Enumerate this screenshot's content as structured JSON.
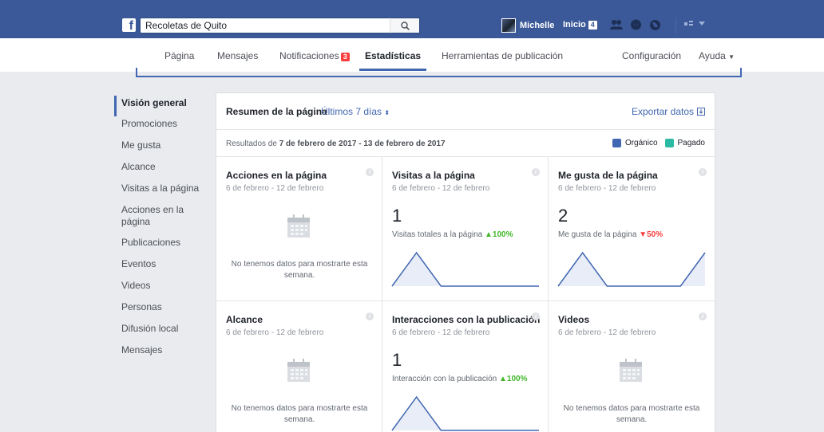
{
  "topbar": {
    "logo": "f",
    "search_value": "Recoletas de Quito",
    "user_name": "Michelle",
    "home_label": "Inicio",
    "home_count": "4"
  },
  "nav": {
    "tabs": [
      "Página",
      "Mensajes",
      "Notificaciones",
      "Estadísticas",
      "Herramientas de publicación",
      "Configuración",
      "Ayuda"
    ],
    "notifications_badge": "3",
    "active_tab": "Estadísticas"
  },
  "sidebar": {
    "items": [
      "Visión general",
      "Promociones",
      "Me gusta",
      "Alcance",
      "Visitas a la página",
      "Acciones en la página",
      "Publicaciones",
      "Eventos",
      "Videos",
      "Personas",
      "Difusión local",
      "Mensajes"
    ]
  },
  "panel": {
    "title": "Resumen de la página",
    "period": "Últimos 7 días",
    "export_label": "Exportar datos",
    "results_prefix": "Resultados de",
    "results_range": "7 de febrero de 2017 - 13 de febrero de 2017",
    "legend_organic": "Orgánico",
    "legend_paid": "Pagado",
    "colors": {
      "organic": "#4267b2",
      "paid": "#2bbba4",
      "up": "#42b72a",
      "down": "#fa3e3e"
    }
  },
  "cards": [
    {
      "title": "Acciones en la página",
      "date": "6 de febrero - 12 de febrero",
      "empty": "No tenemos datos para mostrarte esta semana."
    },
    {
      "title": "Visitas a la página",
      "date": "6 de febrero - 12 de febrero",
      "value": "1",
      "metric": "Visitas totales a la página",
      "change": "100%",
      "trend": [
        0,
        1,
        0,
        0,
        0,
        0,
        0
      ]
    },
    {
      "title": "Me gusta de la página",
      "date": "6 de febrero - 12 de febrero",
      "value": "2",
      "metric": "Me gusta de la página",
      "change": "50%",
      "trend": [
        0,
        1,
        0,
        0,
        0,
        0,
        1
      ]
    },
    {
      "title": "Alcance",
      "date": "6 de febrero - 12 de febrero",
      "empty": "No tenemos datos para mostrarte esta semana."
    },
    {
      "title": "Interacciones con la publicación",
      "date": "6 de febrero - 12 de febrero",
      "value": "1",
      "metric": "Interacción con la publicación",
      "change": "100%",
      "trend": [
        0,
        1,
        0,
        0,
        0,
        0,
        0
      ]
    },
    {
      "title": "Videos",
      "date": "6 de febrero - 12 de febrero",
      "empty": "No tenemos datos para mostrarte esta semana."
    }
  ]
}
